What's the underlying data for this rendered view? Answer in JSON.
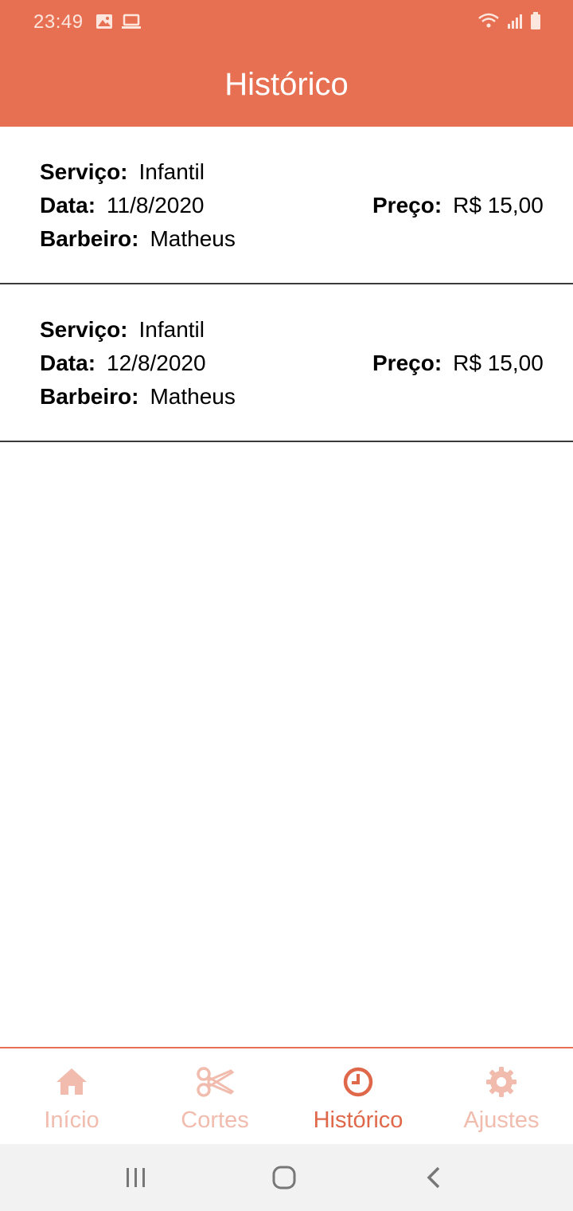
{
  "status_bar": {
    "time": "23:49",
    "left_icons": [
      "image-icon",
      "laptop-icon"
    ],
    "right_icons": [
      "wifi-icon",
      "signal-icon",
      "battery-icon"
    ]
  },
  "header": {
    "title": "Histórico"
  },
  "history": [
    {
      "service_label": "Serviço:",
      "service": "Infantil",
      "date_label": "Data:",
      "date": "11/8/2020",
      "barber_label": "Barbeiro:",
      "barber": "Matheus",
      "price_label": "Preço:",
      "price": "R$ 15,00"
    },
    {
      "service_label": "Serviço:",
      "service": "Infantil",
      "date_label": "Data:",
      "date": "12/8/2020",
      "barber_label": "Barbeiro:",
      "barber": "Matheus",
      "price_label": "Preço:",
      "price": "R$ 15,00"
    }
  ],
  "bottom_nav": {
    "items": [
      {
        "label": "Início",
        "icon": "home-icon",
        "active": false
      },
      {
        "label": "Cortes",
        "icon": "scissors-icon",
        "active": false
      },
      {
        "label": "Histórico",
        "icon": "clock-icon",
        "active": true
      },
      {
        "label": "Ajustes",
        "icon": "gear-icon",
        "active": false
      }
    ]
  },
  "colors": {
    "accent": "#e87052",
    "inactive_nav": "#f1bcad",
    "active_nav": "#e0684a"
  }
}
